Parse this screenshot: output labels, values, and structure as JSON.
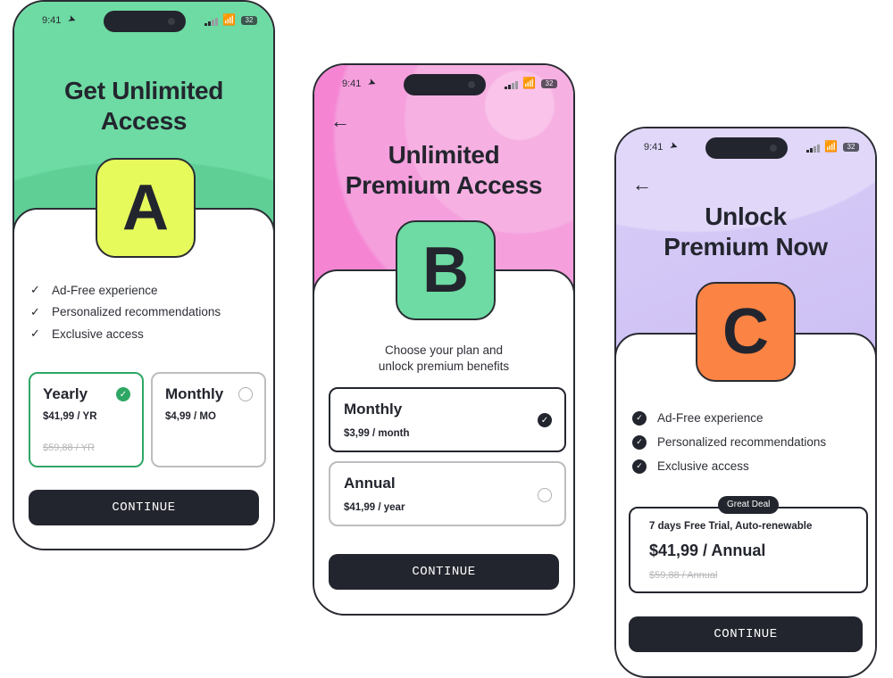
{
  "status_bar": {
    "time": "9:41",
    "battery": "32"
  },
  "variants": [
    {
      "id": "A",
      "title_line1": "Get Unlimited",
      "title_line2": "Access",
      "badge_letter": "A",
      "colors": {
        "header": "#6ddba3",
        "badge": "#e6fa5c",
        "selected": "#2fa764"
      },
      "features": [
        "Ad-Free experience",
        "Personalized recommendations",
        "Exclusive access"
      ],
      "plans": [
        {
          "name": "Yearly",
          "price": "$41,99 / YR",
          "old_price": "$59,88 / YR",
          "selected": true
        },
        {
          "name": "Monthly",
          "price": "$4,99 / MO",
          "selected": false
        }
      ],
      "cta": "CONTINUE"
    },
    {
      "id": "B",
      "title_line1": "Unlimited",
      "title_line2": "Premium Access",
      "badge_letter": "B",
      "colors": {
        "header": "#f68fd8",
        "badge": "#6ddba3",
        "selected": "#23252e"
      },
      "subtitle_line1": "Choose your plan and",
      "subtitle_line2": "unlock premium benefits",
      "plans": [
        {
          "name": "Monthly",
          "price": "$3,99 / month",
          "selected": true
        },
        {
          "name": "Annual",
          "price": "$41,99 / year",
          "selected": false
        }
      ],
      "cta": "CONTINUE"
    },
    {
      "id": "C",
      "title_line1": "Unlock",
      "title_line2": "Premium Now",
      "badge_letter": "C",
      "colors": {
        "header": "#d8cdf7",
        "badge": "#fb8344",
        "selected": "#23252e"
      },
      "features": [
        "Ad-Free experience",
        "Personalized recommendations",
        "Exclusive access"
      ],
      "deal": {
        "tag": "Great Deal",
        "trial": "7 days Free Trial, Auto-renewable",
        "price": "$41,99 / Annual",
        "old_price": "$59,88 / Annual"
      },
      "cta": "CONTINUE"
    }
  ]
}
